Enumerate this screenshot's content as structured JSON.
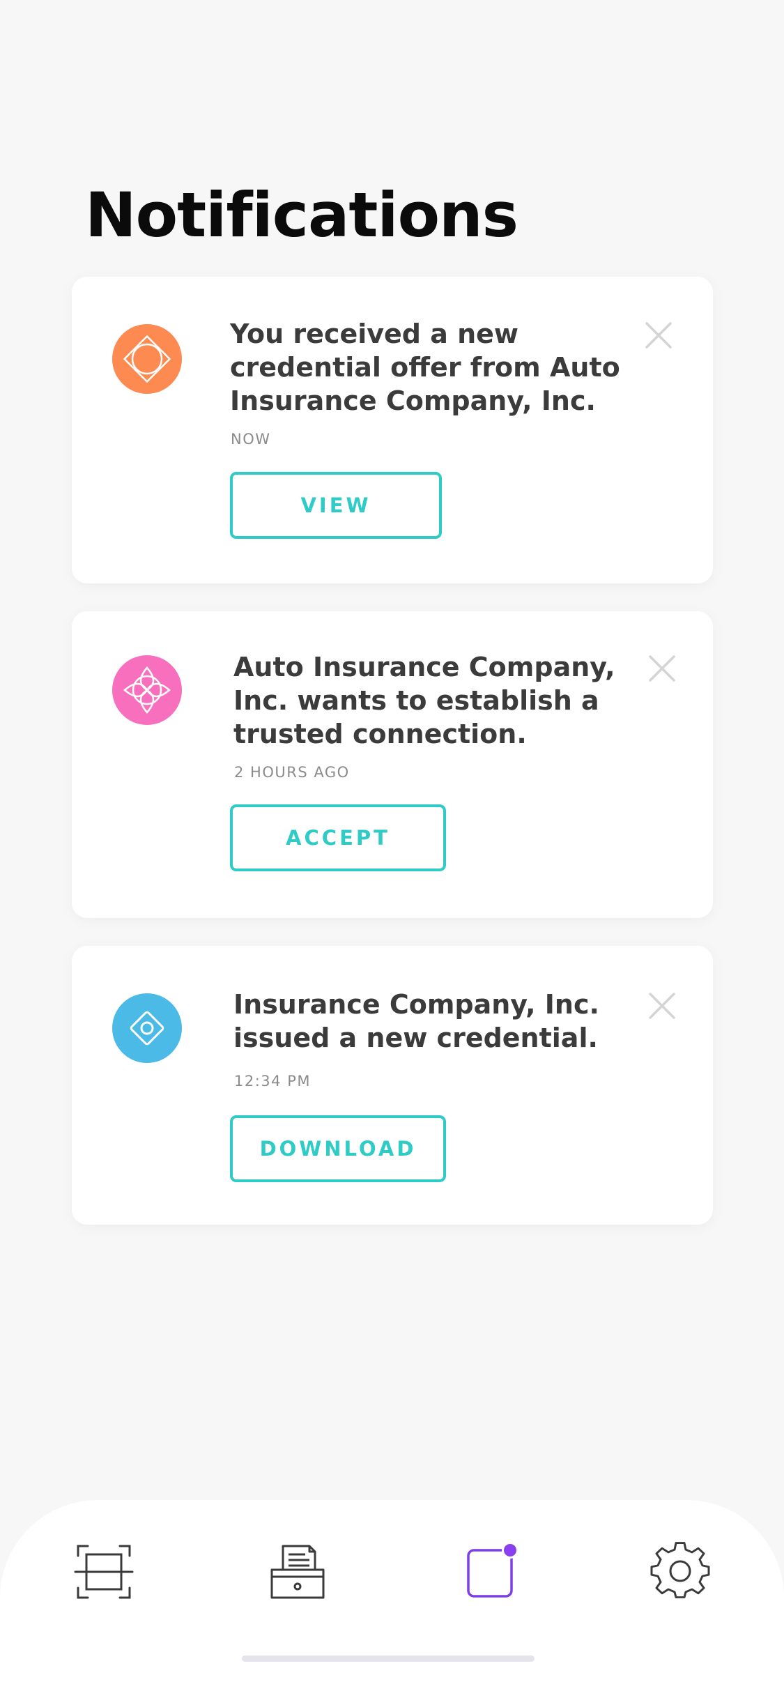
{
  "page": {
    "title": "Notifications"
  },
  "notifications": [
    {
      "icon": "orange-diamond-circle-icon",
      "icon_color": "#fc8a51",
      "message_lines": [
        "You received a new",
        "credential offer from Auto",
        "Insurance Company, Inc."
      ],
      "time": "NOW",
      "action_label": "VIEW"
    },
    {
      "icon": "pink-flower-icon",
      "icon_color": "#f870bd",
      "message_lines": [
        "Auto Insurance Company,",
        "Inc. wants to establish a",
        "trusted connection."
      ],
      "time": "2 HOURS AGO",
      "action_label": "ACCEPT"
    },
    {
      "icon": "blue-diamond-dot-icon",
      "icon_color": "#4bbae6",
      "message_lines": [
        "Insurance Company, Inc.",
        "issued a new credential."
      ],
      "time": "12:34 PM",
      "action_label": "DOWNLOAD"
    }
  ],
  "colors": {
    "accent": "#2fcbc7",
    "tab_active": "#7b3fe4",
    "badge": "#8a3ff0",
    "close": "#d4d4d4",
    "background": "#f7f7f8"
  },
  "tab_bar": {
    "tabs": [
      {
        "icon": "scan-icon",
        "active": false
      },
      {
        "icon": "credential-box-icon",
        "active": false
      },
      {
        "icon": "notifications-icon",
        "active": true,
        "badge": true
      },
      {
        "icon": "gear-icon",
        "active": false
      }
    ]
  }
}
